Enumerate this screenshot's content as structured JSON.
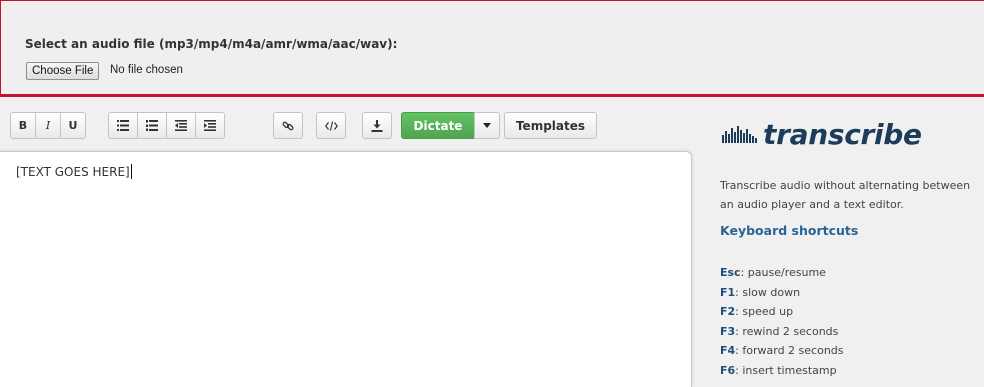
{
  "upload": {
    "label": "Select an audio file (mp3/mp4/m4a/amr/wma/aac/wav):",
    "button_label": "Choose File",
    "status": "No file chosen"
  },
  "toolbar": {
    "bold": "B",
    "italic": "I",
    "underline": "U",
    "icons": {
      "bulleted_list": "bulleted-list-icon",
      "numbered_list": "numbered-list-icon",
      "outdent": "outdent-icon",
      "indent": "indent-icon",
      "link": "link-icon",
      "code": "code-icon",
      "download": "download-icon",
      "caret": "caret-down-icon"
    },
    "dictate": "Dictate",
    "templates": "Templates",
    "accent_color": "#51a351"
  },
  "editor": {
    "content": "[TEXT GOES HERE]"
  },
  "brand": {
    "name": "transcribe",
    "icon": "waveform-icon",
    "color": "#1d3c5a"
  },
  "description": {
    "line1": "Transcribe audio without alternating between",
    "line2": "an audio player and a text editor."
  },
  "shortcuts": {
    "title": "Keyboard shortcuts",
    "items": [
      {
        "key": "Esc",
        "action": ": pause/resume"
      },
      {
        "key": "F1",
        "action": ": slow down"
      },
      {
        "key": "F2",
        "action": ": speed up"
      },
      {
        "key": "F3",
        "action": ": rewind 2 seconds"
      },
      {
        "key": "F4",
        "action": ": forward 2 seconds"
      },
      {
        "key": "F6",
        "action": ": insert timestamp"
      }
    ]
  },
  "colors": {
    "upload_border": "#c8102e",
    "link": "#2a6496"
  }
}
